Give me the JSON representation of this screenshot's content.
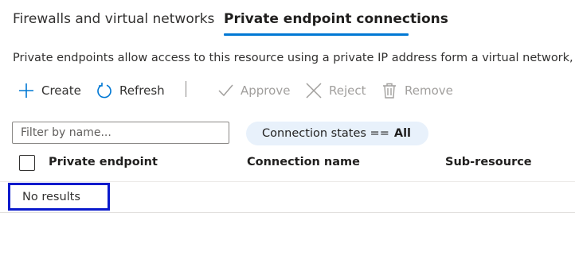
{
  "tabs": [
    {
      "label": "Firewalls and virtual networks",
      "selected": false
    },
    {
      "label": "Private endpoint connections",
      "selected": true
    }
  ],
  "description": "Private endpoints allow access to this resource using a private IP address form a virtual network, effectively",
  "toolbar": {
    "create": {
      "label": "Create",
      "icon": "plus-icon",
      "enabled": true
    },
    "refresh": {
      "label": "Refresh",
      "icon": "refresh-icon",
      "enabled": true
    },
    "approve": {
      "label": "Approve",
      "icon": "checkmark-icon",
      "enabled": false
    },
    "reject": {
      "label": "Reject",
      "icon": "close-icon",
      "enabled": false
    },
    "remove": {
      "label": "Remove",
      "icon": "trash-icon",
      "enabled": false
    }
  },
  "filter": {
    "placeholder": "Filter by name...",
    "value": ""
  },
  "state_filter": {
    "label": "Connection states ==",
    "value": "All"
  },
  "table": {
    "columns": [
      "Private endpoint",
      "Connection name",
      "Sub-resource"
    ],
    "empty_message": "No results"
  },
  "colors": {
    "accent": "#0078d4",
    "pill_background": "#e8f1fb",
    "highlight_border": "#0a1acc",
    "disabled_text": "#a19f9d"
  }
}
